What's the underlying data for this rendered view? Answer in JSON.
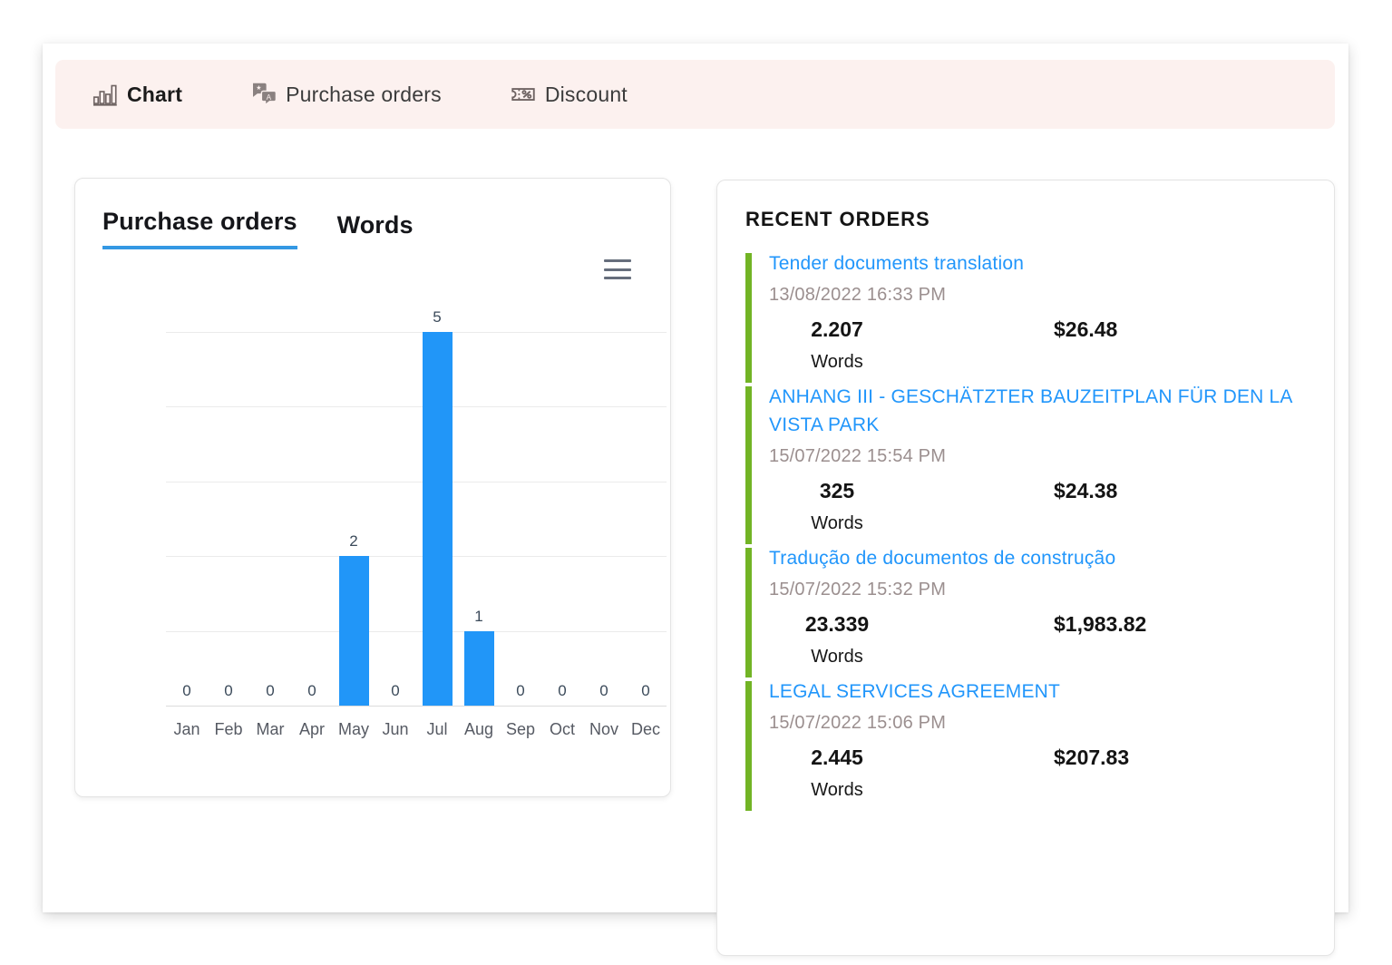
{
  "toolbar": {
    "items": [
      {
        "label": "Chart",
        "icon": "bar-chart-icon",
        "active": true
      },
      {
        "label": "Purchase orders",
        "icon": "translate-icon",
        "active": false
      },
      {
        "label": "Discount",
        "icon": "coupon-percent-icon",
        "active": false
      }
    ]
  },
  "chart_panel": {
    "tabs": [
      {
        "label": "Purchase orders",
        "active": true
      },
      {
        "label": "Words",
        "active": false
      }
    ],
    "context_menu_icon": "hamburger-menu-icon"
  },
  "chart_data": {
    "type": "bar",
    "title": "",
    "subtitle": "",
    "xlabel": "",
    "ylabel": "",
    "categories": [
      "Jan",
      "Feb",
      "Mar",
      "Apr",
      "May",
      "Jun",
      "Jul",
      "Aug",
      "Sep",
      "Oct",
      "Nov",
      "Dec"
    ],
    "values": [
      0,
      0,
      0,
      0,
      2,
      0,
      5,
      1,
      0,
      0,
      0,
      0
    ],
    "data_labels": [
      "0",
      "0",
      "0",
      "0",
      "2",
      "0",
      "5",
      "1",
      "0",
      "0",
      "0",
      "0"
    ],
    "series": [
      {
        "name": "Purchase orders",
        "values": [
          0,
          0,
          0,
          0,
          2,
          0,
          5,
          1,
          0,
          0,
          0,
          0
        ],
        "color": "#2196f8"
      }
    ],
    "ylim": [
      0,
      5
    ],
    "yticks": [
      0,
      1,
      2,
      3,
      4,
      5
    ],
    "ytick_labels_visible": false,
    "grid": true,
    "legend": false,
    "legend_position": "none",
    "bar_color": "#2196f8",
    "data_label_color": "#3b4a5a",
    "gridline_color": "#ebebeb"
  },
  "orders_panel": {
    "title": "RECENT ORDERS",
    "accent_color": "#72b425",
    "link_color": "#2196fb",
    "items": [
      {
        "title": "Tender documents translation",
        "date": "13/08/2022 16:33 PM",
        "words_value": "2.207",
        "words_label": "Words",
        "amount": "$26.48"
      },
      {
        "title": "ANHANG III - GESCHÄTZTER BAUZEITPLAN FÜR DEN LA VISTA PARK",
        "date": "15/07/2022 15:54 PM",
        "words_value": "325",
        "words_label": "Words",
        "amount": "$24.38"
      },
      {
        "title": "Tradução de documentos de construção",
        "date": "15/07/2022 15:32 PM",
        "words_value": "23.339",
        "words_label": "Words",
        "amount": "$1,983.82"
      },
      {
        "title": "LEGAL SERVICES AGREEMENT",
        "date": "15/07/2022 15:06 PM",
        "words_value": "2.445",
        "words_label": "Words",
        "amount": "$207.83"
      }
    ]
  },
  "theme": {
    "toolbar_background": "#fcf1ef",
    "page_background": "#ffffff",
    "accent_blue": "#3498e3",
    "bar_blue": "#2196f8",
    "accent_green": "#72b425"
  }
}
